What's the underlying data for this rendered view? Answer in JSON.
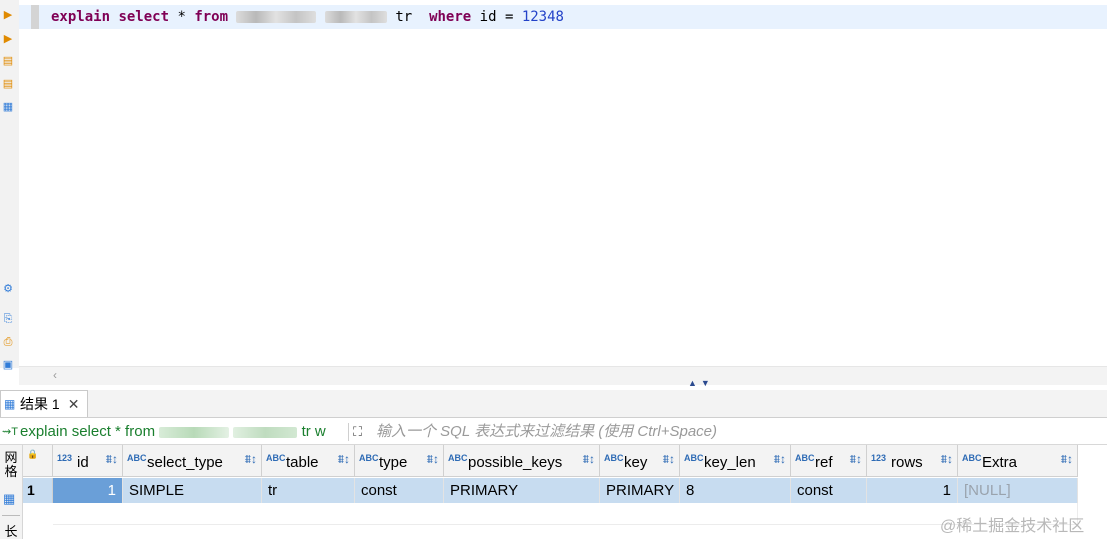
{
  "editor": {
    "sql_tokens": [
      {
        "t": "explain",
        "k": "kw"
      },
      {
        "t": " ",
        "k": ""
      },
      {
        "t": "select",
        "k": "kw"
      },
      {
        "t": " * ",
        "k": ""
      },
      {
        "t": "from",
        "k": "kw"
      },
      {
        "t": " ",
        "k": ""
      }
    ],
    "sql_alias": " tr  ",
    "sql_where": "where",
    "sql_cond": " id = ",
    "sql_value": "12348"
  },
  "results": {
    "tab_label": "结果 1",
    "query_preview_prefix": "explain select * from",
    "query_preview_suffix": " tr w",
    "filter_placeholder": "输入一个 SQL 表达式来过滤结果 (使用 Ctrl+Space)",
    "side_label_top": "网格",
    "side_label_bottom": "长",
    "type_prefix_text": "ABC",
    "type_prefix_num": "123",
    "columns": [
      {
        "name": "id",
        "type": "123"
      },
      {
        "name": "select_type",
        "type": "ABC"
      },
      {
        "name": "table",
        "type": "ABC"
      },
      {
        "name": "type",
        "type": "ABC"
      },
      {
        "name": "possible_keys",
        "type": "ABC"
      },
      {
        "name": "key",
        "type": "ABC"
      },
      {
        "name": "key_len",
        "type": "ABC"
      },
      {
        "name": "ref",
        "type": "ABC"
      },
      {
        "name": "rows",
        "type": "123"
      },
      {
        "name": "Extra",
        "type": "ABC"
      }
    ],
    "rows": [
      {
        "rownum": "1",
        "cells": [
          "1",
          "SIMPLE",
          "tr",
          "const",
          "PRIMARY",
          "PRIMARY",
          "8",
          "const",
          "1",
          "[NULL]"
        ]
      }
    ]
  },
  "watermark": "@稀土掘金技术社区"
}
